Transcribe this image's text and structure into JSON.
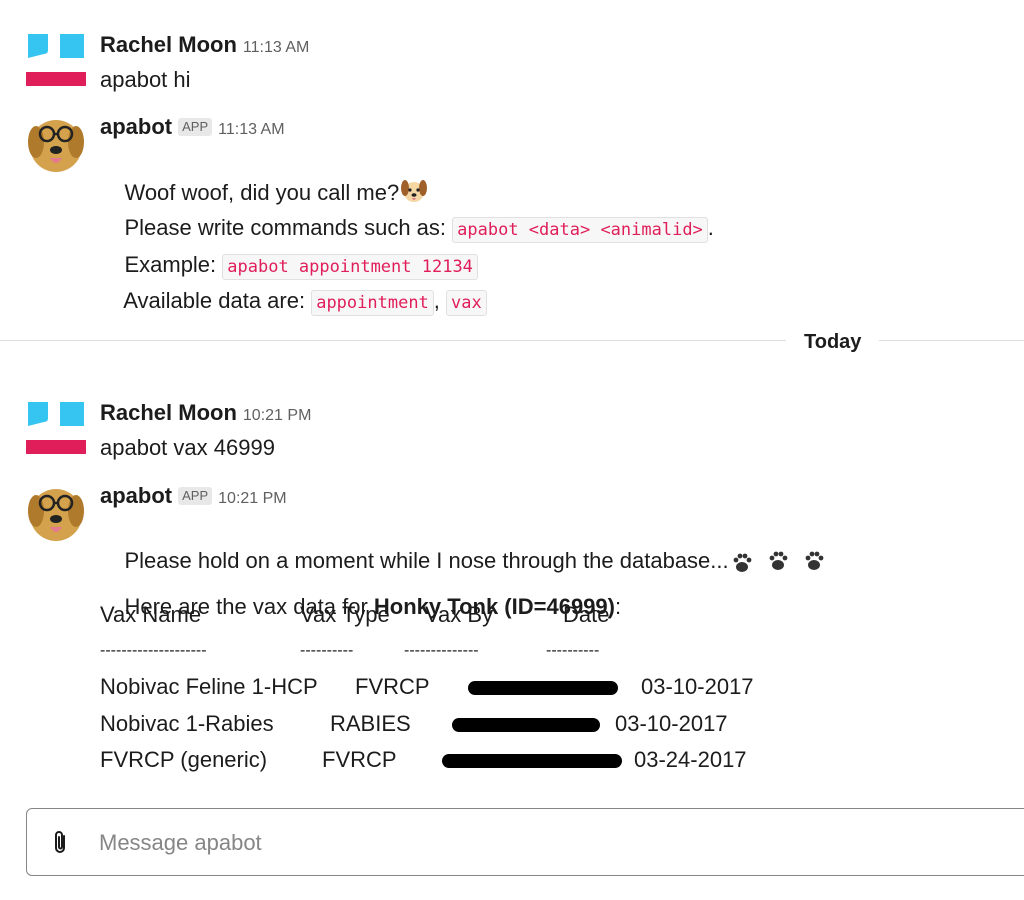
{
  "messages": [
    {
      "author": "Rachel Moon",
      "time": "11:13 AM",
      "text": "apabot hi"
    },
    {
      "author": "apabot",
      "badge": "APP",
      "time": "11:13 AM",
      "line1": "Woof woof, did you call me?",
      "line2_prefix": "Please write commands such as: ",
      "line2_code": "apabot <data> <animalid>",
      "line2_suffix": ".",
      "line3_prefix": "Example: ",
      "line3_code": "apabot appointment 12134",
      "line4_prefix": "Available data are: ",
      "line4_code1": "appointment",
      "line4_sep": ",",
      "line4_code2": "vax"
    },
    {
      "author": "Rachel Moon",
      "time": "10:21 PM",
      "text": "apabot vax 46999"
    },
    {
      "author": "apabot",
      "badge": "APP",
      "time": "10:21 PM",
      "line1": "Please hold on a moment while I nose through the database...",
      "intro_prefix": "Here are the vax data for ",
      "intro_bold": "Honky Tonk (ID=46999)",
      "intro_suffix": ":",
      "table": {
        "headers": [
          "Vax Name",
          "Vax Type",
          "Vax By",
          "Date"
        ],
        "separators": [
          "--------------------",
          "----------",
          "--------------",
          "----------"
        ],
        "rows": [
          {
            "name": "Nobivac Feline 1-HCP",
            "type": "FVRCP",
            "date": "03-10-2017"
          },
          {
            "name": "Nobivac 1-Rabies",
            "type": "RABIES",
            "date": "03-10-2017"
          },
          {
            "name": "FVRCP (generic)",
            "type": "FVRCP",
            "date": "03-24-2017"
          }
        ]
      }
    }
  ],
  "divider": {
    "label": "Today"
  },
  "composer": {
    "placeholder": "Message apabot"
  },
  "colors": {
    "code_text": "#e01e5a",
    "logo_blue": "#36c5f0",
    "logo_red": "#e01e5a"
  },
  "icons": {
    "paperclip": "paperclip-icon",
    "paws": "paw-prints-icon",
    "dog": "dog-face-emoji"
  }
}
